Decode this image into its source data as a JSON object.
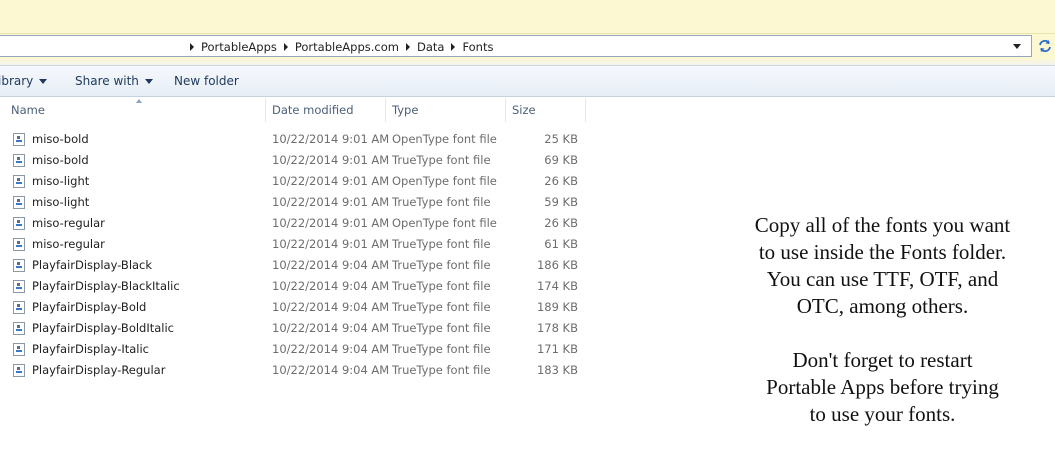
{
  "address_bar": {
    "breadcrumbs": [
      "PortableApps",
      "PortableApps.com",
      "Data",
      "Fonts"
    ]
  },
  "toolbar": {
    "library_label": "ibrary",
    "share_label": "Share with",
    "new_folder_label": "New folder"
  },
  "columns": {
    "name": "Name",
    "date_modified": "Date modified",
    "type": "Type",
    "size": "Size"
  },
  "files": [
    {
      "name": "miso-bold",
      "date": "10/22/2014 9:01 AM",
      "type": "OpenType font file",
      "size": "25 KB"
    },
    {
      "name": "miso-bold",
      "date": "10/22/2014 9:01 AM",
      "type": "TrueType font file",
      "size": "69 KB"
    },
    {
      "name": "miso-light",
      "date": "10/22/2014 9:01 AM",
      "type": "OpenType font file",
      "size": "26 KB"
    },
    {
      "name": "miso-light",
      "date": "10/22/2014 9:01 AM",
      "type": "TrueType font file",
      "size": "59 KB"
    },
    {
      "name": "miso-regular",
      "date": "10/22/2014 9:01 AM",
      "type": "OpenType font file",
      "size": "26 KB"
    },
    {
      "name": "miso-regular",
      "date": "10/22/2014 9:01 AM",
      "type": "TrueType font file",
      "size": "61 KB"
    },
    {
      "name": "PlayfairDisplay-Black",
      "date": "10/22/2014 9:04 AM",
      "type": "TrueType font file",
      "size": "186 KB"
    },
    {
      "name": "PlayfairDisplay-BlackItalic",
      "date": "10/22/2014 9:04 AM",
      "type": "TrueType font file",
      "size": "174 KB"
    },
    {
      "name": "PlayfairDisplay-Bold",
      "date": "10/22/2014 9:04 AM",
      "type": "TrueType font file",
      "size": "189 KB"
    },
    {
      "name": "PlayfairDisplay-BoldItalic",
      "date": "10/22/2014 9:04 AM",
      "type": "TrueType font file",
      "size": "178 KB"
    },
    {
      "name": "PlayfairDisplay-Italic",
      "date": "10/22/2014 9:04 AM",
      "type": "TrueType font file",
      "size": "171 KB"
    },
    {
      "name": "PlayfairDisplay-Regular",
      "date": "10/22/2014 9:04 AM",
      "type": "TrueType font file",
      "size": "183 KB"
    }
  ],
  "note": {
    "para1": [
      "Copy all of the fonts you want",
      "to use inside the Fonts folder.",
      "You can use TTF, OTF, and",
      "OTC, among others."
    ],
    "para2": [
      "Don't forget to restart",
      "Portable Apps before trying",
      "to use your fonts."
    ]
  },
  "icons": {
    "file": "font-file-icon",
    "refresh": "refresh-icon"
  },
  "colors": {
    "title_band": "#fcf8d2",
    "toolbar_text": "#1e395b",
    "header_text": "#4c607a",
    "secondary_text": "#6d6d6d"
  }
}
